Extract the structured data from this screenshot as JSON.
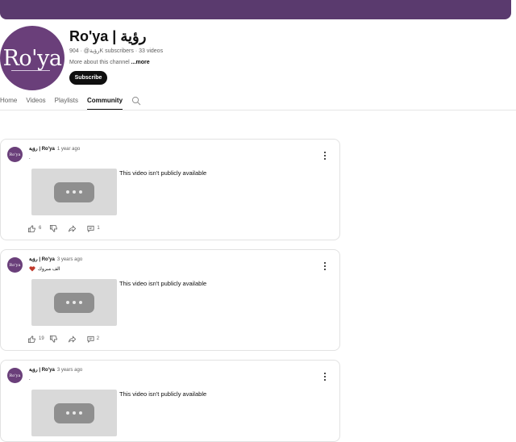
{
  "channel": {
    "name": "Ro'ya | رؤية",
    "avatar_text": "Ro'ya",
    "meta": "رؤية@ · 904K subscribers · 33 videos",
    "about_prefix": "More about this channel ",
    "about_more": "...more",
    "subscribe_label": "Subscribe"
  },
  "tabs": [
    {
      "label": "Home"
    },
    {
      "label": "Videos"
    },
    {
      "label": "Playlists"
    },
    {
      "label": "Community",
      "active": true
    }
  ],
  "posts": [
    {
      "author": "رؤية | Ro'ya",
      "time": "1 year ago",
      "text": ".",
      "video_status": "This video isn't publicly available",
      "likes": "6",
      "comments": "1"
    },
    {
      "author": "رؤية | Ro'ya",
      "time": "3 years ago",
      "text": "الف مبروك",
      "video_status": "This video isn't publicly available",
      "likes": "19",
      "comments": "2"
    },
    {
      "author": "رؤية | Ro'ya",
      "time": "3 years ago",
      "text": ".",
      "video_status": "This video isn't publicly available",
      "likes": "",
      "comments": ""
    }
  ],
  "colors": {
    "brand_purple": "#6a3f7a",
    "banner": "#5a3a6e",
    "subscribe_bg": "#0f0f0f",
    "heart": "#c0392b"
  }
}
